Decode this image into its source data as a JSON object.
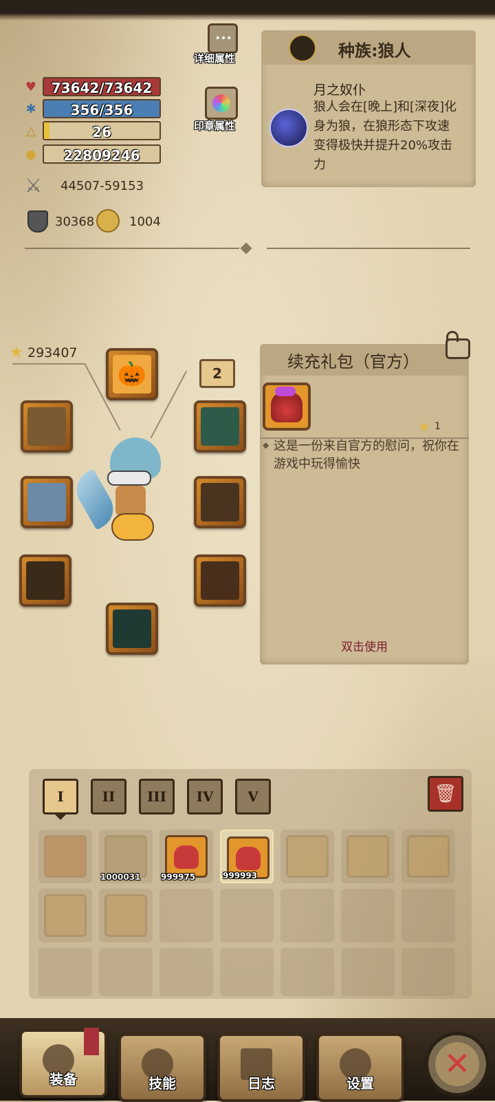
{
  "stats": {
    "hp": "73642/73642",
    "mp": "356/356",
    "level": "26",
    "gold": "22809246",
    "attack": "44507-59153",
    "armor": "30368",
    "speed": "1004"
  },
  "buttons": {
    "detail_attrs": "详细属性",
    "seal_attrs": "印章属性"
  },
  "race": {
    "title": "种族:狼人",
    "trait_name": "月之奴仆",
    "trait_desc": "狼人会在[晚上]和[深夜]化身为狼，在狼形态下攻速变得极快并提升20%攻击力"
  },
  "equipment": {
    "score": "293407",
    "slot_badge": "2"
  },
  "item_detail": {
    "title": "续充礼包（官方）",
    "stars": "1",
    "desc": "这是一份来自官方的慰问，祝你在游戏中玩得愉快",
    "hint": "双击使用"
  },
  "bag_tabs": [
    "I",
    "II",
    "III",
    "IV",
    "V"
  ],
  "inventory": {
    "qty_1": "1000031",
    "qty_2": "999975",
    "qty_3": "999993"
  },
  "nav": {
    "equip": "装备",
    "skills": "技能",
    "log": "日志",
    "settings": "设置"
  },
  "colors": {
    "hp": "#a83a3a",
    "mp": "#4b7fb3",
    "panel": "#cdbb96",
    "slot_orange": "#e3962c"
  }
}
